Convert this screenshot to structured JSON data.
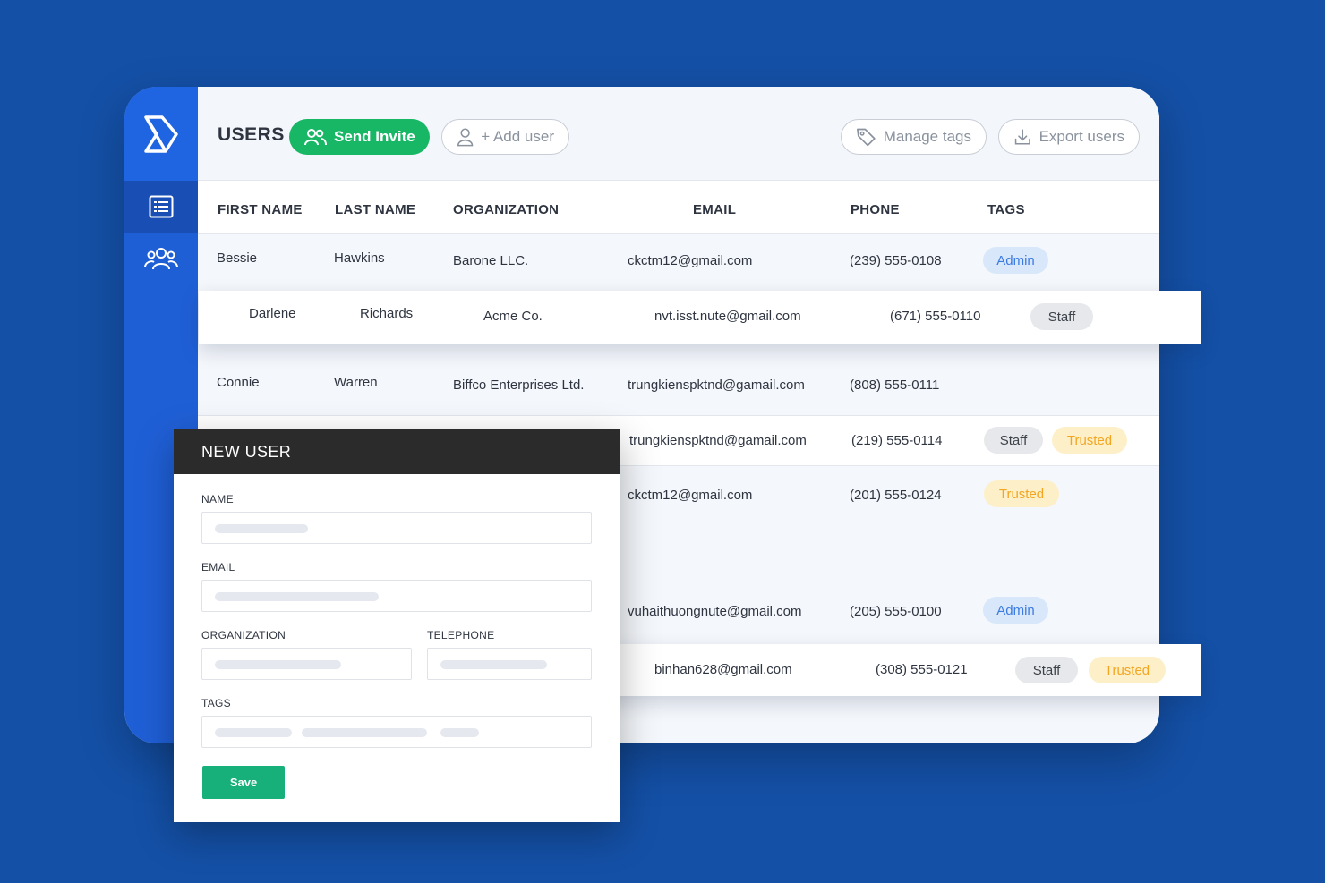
{
  "header": {
    "title": "USERS",
    "send_invite": "Send Invite",
    "add_user": "+ Add user",
    "manage_tags": "Manage tags",
    "export_users": "Export users"
  },
  "table": {
    "columns": [
      "FIRST NAME",
      "LAST NAME",
      "ORGANIZATION",
      "EMAIL",
      "PHONE",
      "TAGS"
    ],
    "rows": [
      {
        "first": "Bessie",
        "last": "Hawkins",
        "org": "Barone LLC.",
        "email": "ckctm12@gmail.com",
        "phone": "(239) 555-0108",
        "tags": [
          "Admin"
        ]
      },
      {
        "first": "Darlene",
        "last": "Richards",
        "org": "Acme Co.",
        "email": "nvt.isst.nute@gmail.com",
        "phone": "(671) 555-0110",
        "tags": [
          "Staff"
        ]
      },
      {
        "first": "Connie",
        "last": "Warren",
        "org": "Biffco Enterprises Ltd.",
        "email": "trungkienspktnd@gamail.com",
        "phone": "(808) 555-0111",
        "tags": []
      },
      {
        "first": "",
        "last": "",
        "org": "",
        "email": "trungkienspktnd@gamail.com",
        "phone": "(219) 555-0114",
        "tags": [
          "Staff",
          "Trusted"
        ]
      },
      {
        "first": "",
        "last": "",
        "org": "",
        "email": "ckctm12@gmail.com",
        "phone": "(201) 555-0124",
        "tags": [
          "Trusted"
        ]
      },
      {
        "first": "",
        "last": "",
        "org": "",
        "email": "vuhaithuongnute@gmail.com",
        "phone": "(205) 555-0100",
        "tags": [
          "Admin"
        ]
      },
      {
        "first": "",
        "last": "",
        "org": "",
        "email": "binhan628@gmail.com",
        "phone": "(308) 555-0121",
        "tags": [
          "Staff",
          "Trusted"
        ]
      }
    ]
  },
  "modal": {
    "title": "NEW USER",
    "name_label": "NAME",
    "email_label": "EMAIL",
    "org_label": "ORGANIZATION",
    "tel_label": "TELEPHONE",
    "tags_label": "TAGS",
    "save_label": "Save"
  },
  "colors": {
    "background": "#1450a6",
    "sidebar": "#1f5fd6",
    "invite_green": "#17b765",
    "save_green": "#17b07a",
    "admin_tag": "#3b7be0",
    "trusted_tag": "#f3a520"
  },
  "icons": {
    "logo": "logo-icon",
    "list": "list-icon",
    "users": "users-icon",
    "invite": "user-group-icon",
    "add_user": "user-icon",
    "tag": "tag-icon",
    "export": "download-icon"
  }
}
